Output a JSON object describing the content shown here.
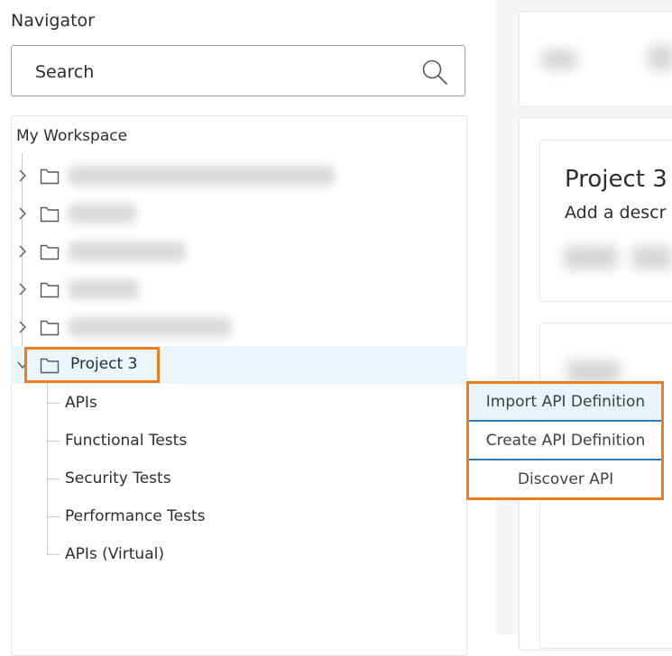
{
  "navigator": {
    "title": "Navigator",
    "search": {
      "placeholder": "Search"
    },
    "workspace_label": "My Workspace",
    "project": {
      "label": "Project 3",
      "children": [
        "APIs",
        "Functional Tests",
        "Security Tests",
        "Performance Tests",
        "APIs (Virtual)"
      ]
    }
  },
  "project_panel": {
    "heading": "Project 3",
    "description": "Add a descr"
  },
  "context_menu": {
    "items": [
      "Import API Definition",
      "Create API Definition",
      "Discover API"
    ]
  },
  "colors": {
    "highlight_orange": "#f07d1a",
    "selection_blue": "#eaf5fc",
    "separator_blue": "#2b7bbf"
  }
}
